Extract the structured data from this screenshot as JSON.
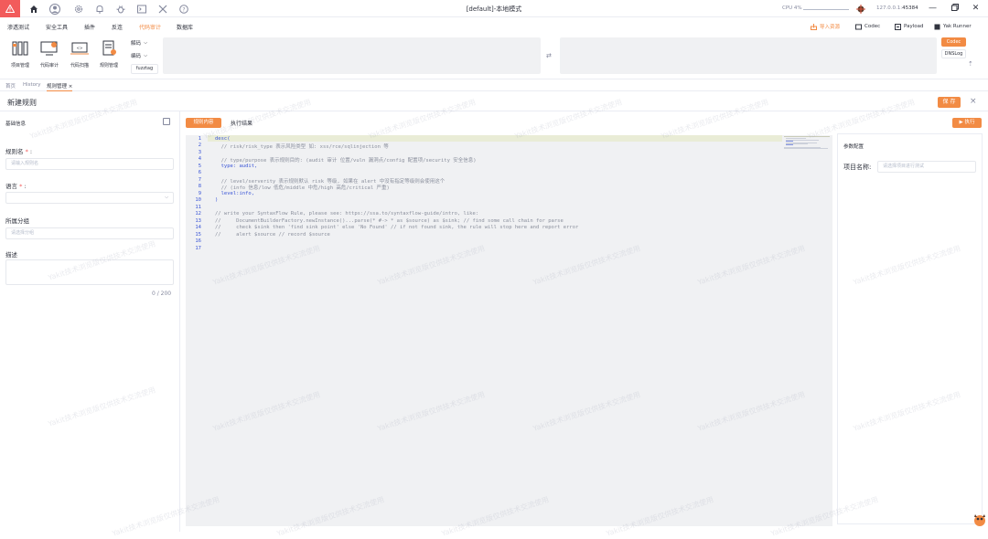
{
  "titlebar": {
    "title": "[default]-本地模式",
    "cpu_label": "CPU 4%",
    "ip_prefix": "127.0.0.1:",
    "port": "45384"
  },
  "menu": {
    "items": [
      "渗透测试",
      "安全工具",
      "插件",
      "反连",
      "代码审计",
      "数据库"
    ],
    "active_index": 4,
    "import_label": "导入资源",
    "codec_label": "Codec",
    "payload_label": "Payload",
    "yak_runner_label": "Yak Runner"
  },
  "toolbar": {
    "tools": [
      "项目管理",
      "代码审计",
      "代码扫描",
      "规则管理"
    ],
    "decode_label": "解码",
    "encode_label": "编码",
    "fuzztag_label": "fuzztag",
    "codec_button": "Codec",
    "dnslog_button": "DNSLog"
  },
  "tabs": {
    "items": [
      "首页",
      "History",
      "规则管理"
    ]
  },
  "page": {
    "title": "新建规则",
    "save_label": "保 存"
  },
  "left_panel": {
    "section_title": "基础信息",
    "rule_name_label": "规则名",
    "rule_name_placeholder": "请输入规则名",
    "language_label": "语言",
    "group_label": "所属分组",
    "group_placeholder": "请选择分组",
    "desc_label": "描述",
    "desc_count": "0 / 200"
  },
  "editor": {
    "tab_rule": "规则内容",
    "tab_result": "执行结果",
    "line_numbers": [
      "1",
      "2",
      "3",
      "4",
      "5",
      "6",
      "7",
      "8",
      "9",
      "10",
      "11",
      "12",
      "13",
      "14",
      "15",
      "16",
      "17"
    ],
    "lines": [
      "desc(",
      "  // risk/risk_type 表示风险类型 如: xss/rce/sqlinjection 等",
      "",
      "  // type/purpose 表示规则目的: (audit 审计 位置/vuln 漏洞点/config 配置项/security 安全信息)",
      "  type: audit,",
      "",
      "  // level/serverity 表示规则默认 risk 等级, 如果在 alert 中没有指定等级则会使用这个",
      "  // (info 信息/low 低危/middle 中危/high 高危/critical 严重)",
      "  level:info,",
      ")",
      "",
      "// write your SyntaxFlow Rule, please see: https://ssa.to/syntaxflow-guide/intro, like:",
      "//     DocumentBuilderFactory.newInstance()...parse(* #-> * as $source) as $sink; // find some call chain for parse",
      "//     check $sink then 'find sink point' else 'No Found' // if not found sink, the rule will stop here and report error",
      "//     alert $source // record $source",
      "",
      ""
    ]
  },
  "right_panel": {
    "run_label": "执行",
    "params_title": "参数配置",
    "project_label": "项目名称:",
    "project_placeholder": "请选择项目进行测试"
  },
  "watermark_text": "Yakit技术浏览版仅供技术交流使用"
}
